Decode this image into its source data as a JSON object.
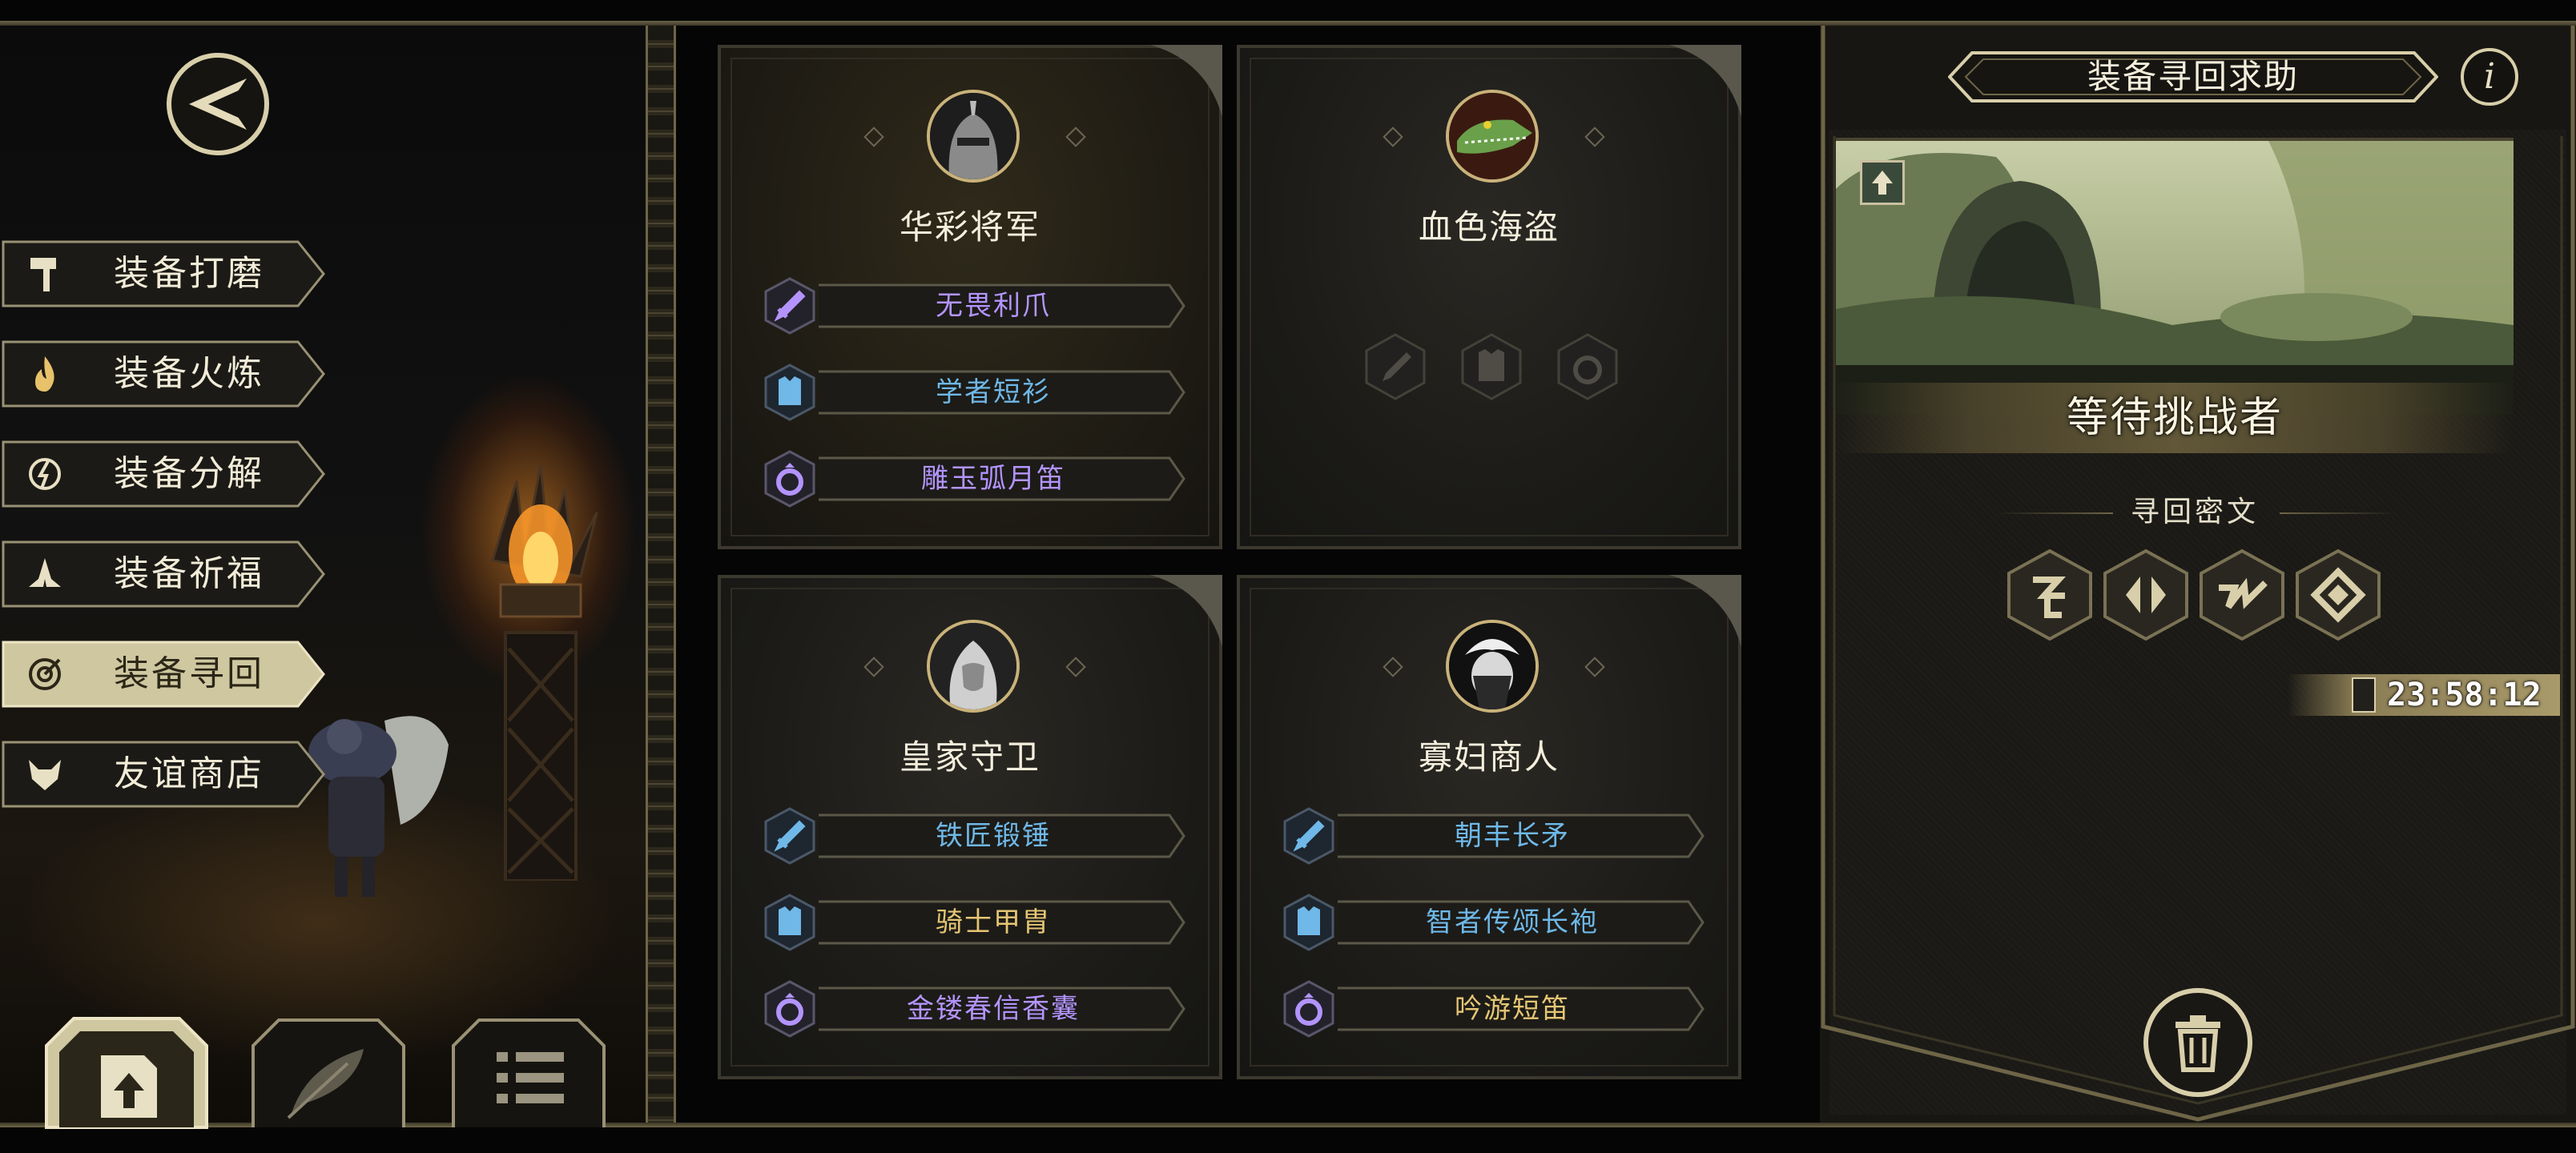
{
  "menu": [
    {
      "label": "装备打磨",
      "icon": "hammer-icon"
    },
    {
      "label": "装备火炼",
      "icon": "flame-icon"
    },
    {
      "label": "装备分解",
      "icon": "decompose-icon"
    },
    {
      "label": "装备祈福",
      "icon": "pray-icon"
    },
    {
      "label": "装备寻回",
      "icon": "target-icon",
      "active": true
    },
    {
      "label": "友谊商店",
      "icon": "fox-icon"
    }
  ],
  "bottom_tabs": [
    "upload-icon",
    "feather-icon",
    "list-icon"
  ],
  "cards": [
    {
      "name": "华彩将军",
      "portrait": "knight-helmet-portrait",
      "items": [
        {
          "label": "无畏利爪",
          "type": "weapon",
          "color": "purple"
        },
        {
          "label": "学者短衫",
          "type": "armor",
          "color": "blue"
        },
        {
          "label": "雕玉弧月笛",
          "type": "accessory",
          "color": "purple"
        }
      ]
    },
    {
      "name": "血色海盗",
      "portrait": "crocodile-pirate-portrait",
      "items": []
    },
    {
      "name": "皇家守卫",
      "portrait": "royal-guard-portrait",
      "items": [
        {
          "label": "铁匠锻锤",
          "type": "weapon",
          "color": "blue"
        },
        {
          "label": "骑士甲胄",
          "type": "armor",
          "color": "gold"
        },
        {
          "label": "金镂春信香囊",
          "type": "accessory",
          "color": "purple"
        }
      ]
    },
    {
      "name": "寡妇商人",
      "portrait": "widow-merchant-portrait",
      "items": [
        {
          "label": "朝丰长矛",
          "type": "weapon",
          "color": "blue"
        },
        {
          "label": "智者传颂长袍",
          "type": "armor",
          "color": "blue"
        },
        {
          "label": "吟游短笛",
          "type": "accessory",
          "color": "gold"
        }
      ]
    }
  ],
  "panel": {
    "title": "装备寻回求助",
    "info_icon": "i",
    "status": "等待挑战者",
    "cipher_title": "寻回密文",
    "runes": [
      "rune-1-icon",
      "rune-2-icon",
      "rune-3-icon",
      "rune-4-icon"
    ],
    "timer": "23:58:12"
  },
  "colors": {
    "purple": "#b394ff",
    "blue": "#6fb8e8",
    "gold": "#e6c674",
    "frame": "#d8cfaa"
  }
}
